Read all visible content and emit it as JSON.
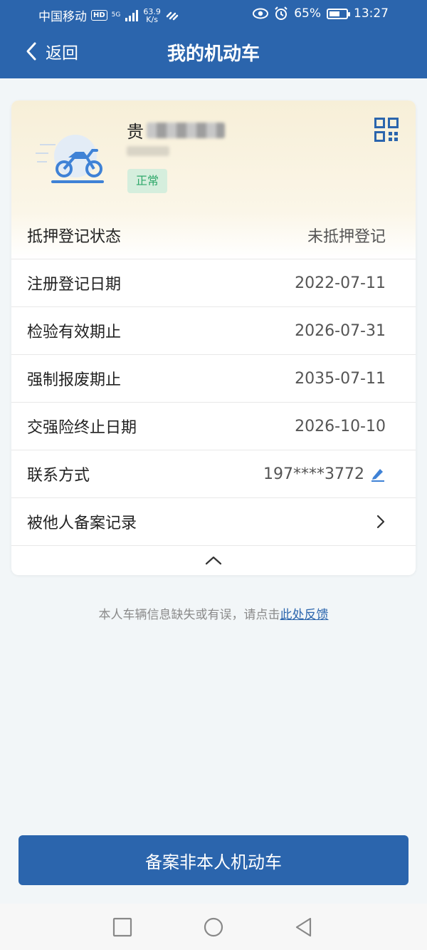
{
  "status_bar": {
    "carrier": "中国移动",
    "hd": "HD",
    "net": "5G",
    "speed_value": "63.9",
    "speed_unit": "K/s",
    "battery": "65%",
    "battery_level": 0.65,
    "time": "13:27"
  },
  "nav": {
    "back_label": "返回",
    "title": "我的机动车"
  },
  "vehicle": {
    "owner_initial": "贵",
    "status": "正常"
  },
  "rows": [
    {
      "label": "抵押登记状态",
      "value": "未抵押登记"
    },
    {
      "label": "注册登记日期",
      "value": "2022-07-11"
    },
    {
      "label": "检验有效期止",
      "value": "2026-07-31"
    },
    {
      "label": "强制报废期止",
      "value": "2035-07-11"
    },
    {
      "label": "交强险终止日期",
      "value": "2026-10-10"
    },
    {
      "label": "联系方式",
      "value": "197****3772"
    },
    {
      "label": "被他人备案记录",
      "value": ""
    }
  ],
  "feedback": {
    "text": "本人车辆信息缺失或有误，请点击",
    "link": "此处反馈"
  },
  "primary_button": "备案非本人机动车",
  "colors": {
    "brand": "#2b65ad",
    "badge_bg": "#d5eedd",
    "badge_text": "#2ea86a"
  }
}
